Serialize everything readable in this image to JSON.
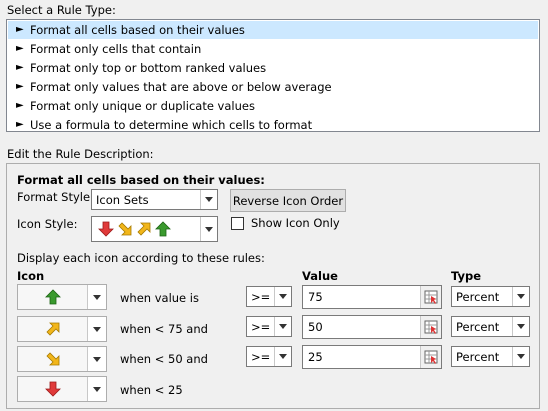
{
  "rule_type": {
    "heading": "Select a Rule Type:",
    "items": [
      {
        "label": "Format all cells based on their values",
        "selected": true
      },
      {
        "label": "Format only cells that contain",
        "selected": false
      },
      {
        "label": "Format only top or bottom ranked values",
        "selected": false
      },
      {
        "label": "Format only values that are above or below average",
        "selected": false
      },
      {
        "label": "Format only unique or duplicate values",
        "selected": false
      },
      {
        "label": "Use a formula to determine which cells to format",
        "selected": false
      }
    ]
  },
  "description": {
    "heading": "Edit the Rule Description:",
    "subheading": "Format all cells based on their values:",
    "format_style_label": "Format Style:",
    "format_style_value": "Icon Sets",
    "reverse_button": "Reverse Icon Order",
    "icon_style_label": "Icon Style:",
    "show_icon_only_label": "Show Icon Only",
    "show_icon_only_checked": false,
    "display_label": "Display each icon according to these rules:",
    "col_icon": "Icon",
    "col_value": "Value",
    "col_type": "Type",
    "rules": [
      {
        "icon": "green-up-arrow",
        "when": "when value is",
        "operator": ">=",
        "value": "75",
        "type": "Percent"
      },
      {
        "icon": "yellow-up-right-arrow",
        "when": "when < 75 and",
        "operator": ">=",
        "value": "50",
        "type": "Percent"
      },
      {
        "icon": "yellow-down-right-arrow",
        "when": "when < 50 and",
        "operator": ">=",
        "value": "25",
        "type": "Percent"
      },
      {
        "icon": "red-down-arrow",
        "when": "when < 25"
      }
    ]
  },
  "colors": {
    "selection": "#cce8ff",
    "green": "#3a9a2e",
    "yellow": "#f2b61a",
    "red": "#e03a3a"
  }
}
